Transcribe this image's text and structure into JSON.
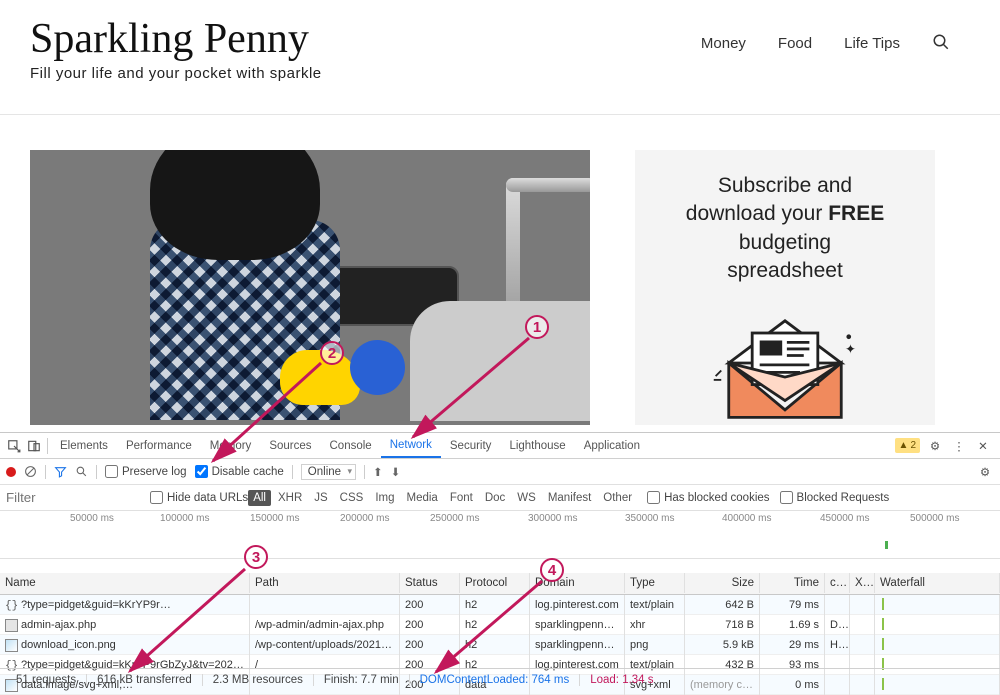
{
  "header": {
    "logo": "Sparkling Penny",
    "tagline": "Fill your life and your pocket with sparkle",
    "nav": [
      "Money",
      "Food",
      "Life Tips"
    ]
  },
  "subscribe": {
    "line1": "Subscribe and",
    "line2_pre": "download your ",
    "line2_strong": "FREE",
    "line3": "budgeting",
    "line4": "spreadsheet"
  },
  "devtools": {
    "tabs": [
      "Elements",
      "Performance",
      "Memory",
      "Sources",
      "Console",
      "Network",
      "Security",
      "Lighthouse",
      "Application"
    ],
    "active_tab": "Network",
    "warnings": "2",
    "toolbar": {
      "preserve_log": "Preserve log",
      "preserve_log_checked": false,
      "disable_cache": "Disable cache",
      "disable_cache_checked": true,
      "throttle": "Online"
    },
    "filter": {
      "placeholder": "Filter",
      "hide_data_urls": "Hide data URLs",
      "types": [
        "All",
        "XHR",
        "JS",
        "CSS",
        "Img",
        "Media",
        "Font",
        "Doc",
        "WS",
        "Manifest",
        "Other"
      ],
      "active_type": "All",
      "has_blocked": "Has blocked cookies",
      "blocked_req": "Blocked Requests"
    },
    "timeline_ticks": [
      "50000 ms",
      "100000 ms",
      "150000 ms",
      "200000 ms",
      "250000 ms",
      "300000 ms",
      "350000 ms",
      "400000 ms",
      "450000 ms",
      "500000 ms"
    ],
    "columns": [
      "Name",
      "Path",
      "Status",
      "Protocol",
      "Domain",
      "Type",
      "Size",
      "Time",
      "cf…",
      "X-…",
      "Waterfall"
    ],
    "rows": [
      {
        "name": "?type=pidget&guid=kKrYP9r…",
        "path": "",
        "status": "200",
        "protocol": "h2",
        "domain": "log.pinterest.com",
        "rtype": "text/plain",
        "size": "642 B",
        "time": "79 ms",
        "cf": "",
        "icon": "brace"
      },
      {
        "name": "admin-ajax.php",
        "path": "/wp-admin/admin-ajax.php",
        "status": "200",
        "protocol": "h2",
        "domain": "sparklingpenny.com",
        "rtype": "xhr",
        "size": "718 B",
        "time": "1.69 s",
        "cf": "D…",
        "icon": "doc"
      },
      {
        "name": "download_icon.png",
        "path": "/wp-content/uploads/2021/01…",
        "status": "200",
        "protocol": "h2",
        "domain": "sparklingpenny.com",
        "rtype": "png",
        "size": "5.9 kB",
        "time": "29 ms",
        "cf": "HIT",
        "icon": "img"
      },
      {
        "name": "?type=pidget&guid=kKrYP9rGbZyJ&tv=202102…",
        "path": "/",
        "status": "200",
        "protocol": "h2",
        "domain": "log.pinterest.com",
        "rtype": "text/plain",
        "size": "432 B",
        "time": "93 ms",
        "cf": "",
        "icon": "brace"
      },
      {
        "name": "data:image/svg+xml;…",
        "path": "",
        "status": "200",
        "protocol": "data",
        "domain": "",
        "rtype": "svg+xml",
        "size": "(memory cac…",
        "time": "0 ms",
        "cf": "",
        "icon": "img"
      }
    ],
    "status": {
      "requests": "51 requests",
      "transferred": "616 kB transferred",
      "resources": "2.3 MB resources",
      "finish": "Finish: 7.7 min",
      "dom": "DOMContentLoaded: 764 ms",
      "load": "Load: 1.34 s"
    }
  },
  "annotations": {
    "n1": "1",
    "n2": "2",
    "n3": "3",
    "n4": "4"
  }
}
